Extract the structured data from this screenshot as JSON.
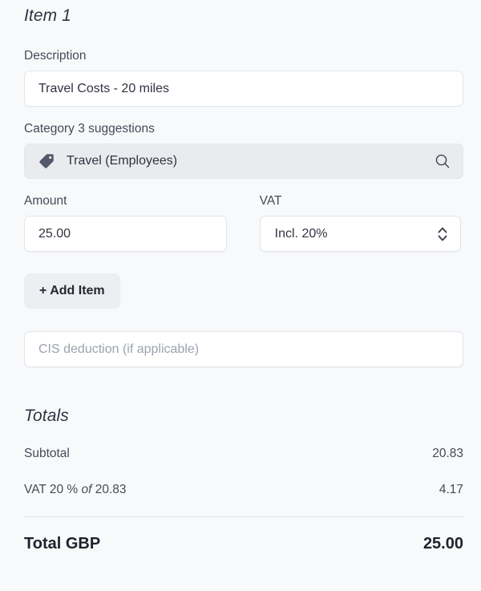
{
  "item": {
    "heading": "Item 1",
    "description": {
      "label": "Description",
      "value": "Travel Costs - 20 miles"
    },
    "category": {
      "label": "Category 3 suggestions",
      "suggestion": "Travel (Employees)",
      "tag_icon": "tag-icon",
      "search_icon": "search-icon"
    },
    "amount": {
      "label": "Amount",
      "value": "25.00"
    },
    "vat": {
      "label": "VAT",
      "value": "Incl. 20%",
      "options": [
        "Incl. 20%"
      ],
      "stepper_icon": "chevron-up-down-icon"
    },
    "add_item_label": "+ Add Item"
  },
  "cis": {
    "placeholder": "CIS deduction (if applicable)",
    "value": ""
  },
  "totals": {
    "heading": "Totals",
    "rows": [
      {
        "label": "Subtotal",
        "value": "20.83"
      }
    ],
    "vat_row": {
      "prefix": "VAT 20 % ",
      "emphasis": "of",
      "suffix": " 20.83",
      "value": "4.17"
    },
    "grand": {
      "label": "Total GBP",
      "value": "25.00"
    }
  },
  "colors": {
    "page_background": "#f8f9fb",
    "input_background": "#ffffff",
    "input_border": "#e2e5ea",
    "suggestion_background": "#eaebee",
    "button_background": "#eceef1",
    "text_primary": "#2f3440",
    "text_secondary": "#454b57",
    "placeholder": "#9ba2ae",
    "tag_icon": "#545a6b",
    "divider": "#e3e5ea"
  }
}
